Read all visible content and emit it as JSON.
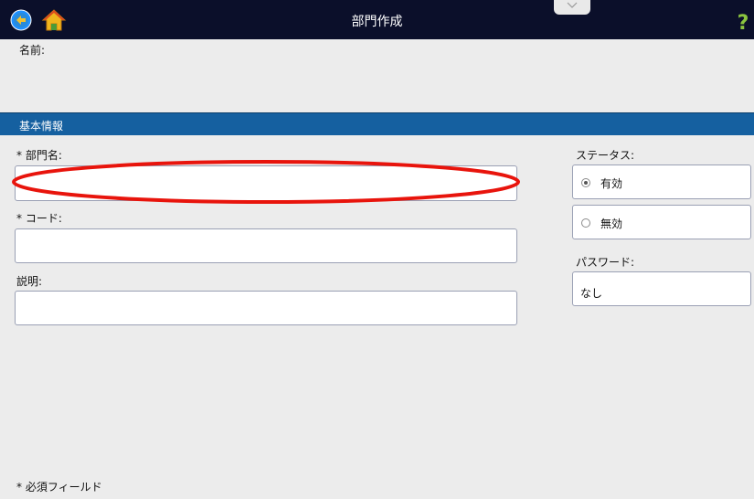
{
  "header": {
    "title": "部門作成",
    "back_icon": "arrow-left-circle-icon",
    "home_icon": "house-icon",
    "help_label": "?"
  },
  "name_section": {
    "label": "名前:"
  },
  "basic_info": {
    "title": "基本情報",
    "department_name_label": "* 部門名:",
    "department_name_value": "",
    "code_label": "* コード:",
    "code_value": "",
    "description_label": "説明:",
    "description_value": ""
  },
  "status": {
    "label": "ステータス:",
    "options": [
      {
        "label": "有効",
        "selected": true
      },
      {
        "label": "無効",
        "selected": false
      }
    ]
  },
  "password": {
    "label": "パスワード:",
    "value": "なし"
  },
  "footer": {
    "required_note": "* 必須フィールド"
  },
  "colors": {
    "topbar": "#0b0f2a",
    "section_header": "#1560a0",
    "background": "#ececec",
    "help": "#8bc53f",
    "annotation": "#e8140c"
  }
}
